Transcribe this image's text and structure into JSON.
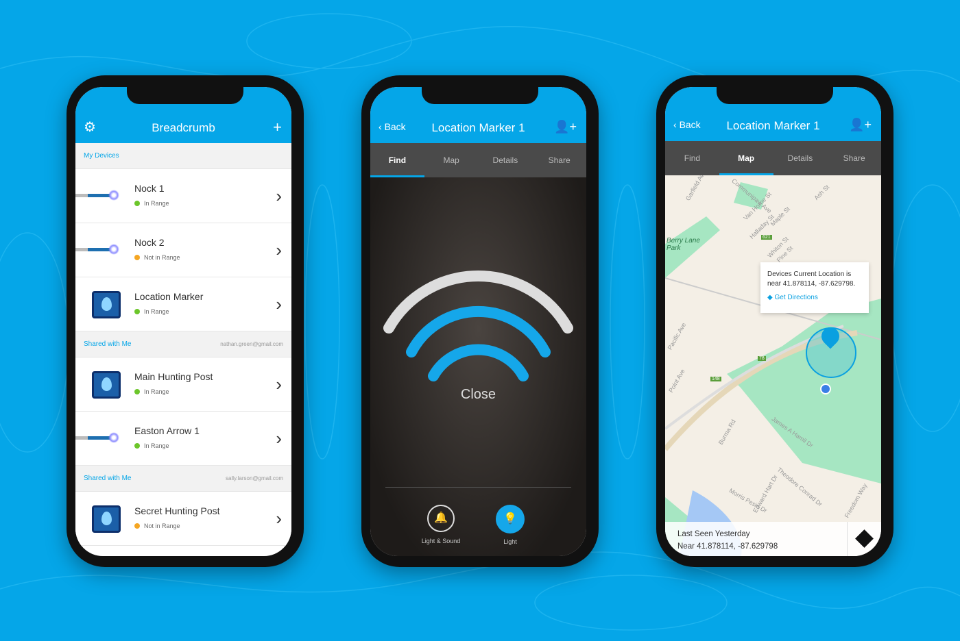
{
  "colors": {
    "accent": "#05a6e8",
    "in_range": "#6cc62a",
    "not_in_range": "#f5a623",
    "tab_bar": "#4a4a4a",
    "park": "#a6e6c2"
  },
  "phone1": {
    "title": "Breadcrumb",
    "left_icon": "gear-icon",
    "right_icon": "plus-icon",
    "sections": [
      {
        "label": "My Devices",
        "email": "",
        "devices": [
          {
            "name": "Nock 1",
            "status": "In Range",
            "type": "nock"
          },
          {
            "name": "Nock 2",
            "status": "Not in Range",
            "type": "nock"
          },
          {
            "name": "Location Marker",
            "status": "In Range",
            "type": "marker"
          }
        ]
      },
      {
        "label": "Shared with Me",
        "email": "nathan.green@gmail.com",
        "devices": [
          {
            "name": "Main Hunting Post",
            "status": "In Range",
            "type": "marker"
          },
          {
            "name": "Easton Arrow 1",
            "status": "In Range",
            "type": "nock"
          }
        ]
      },
      {
        "label": "Shared with Me",
        "email": "sally.larson@gmail.com",
        "devices": [
          {
            "name": "Secret Hunting Post",
            "status": "Not in Range",
            "type": "marker"
          }
        ]
      }
    ]
  },
  "phone2": {
    "back": "Back",
    "title": "Location Marker 1",
    "tabs": [
      "Find",
      "Map",
      "Details",
      "Share"
    ],
    "active_tab": "Find",
    "proximity": "Close",
    "signal_bars_active": 2,
    "signal_bars_total": 3,
    "actions": [
      {
        "label": "Light & Sound",
        "icon": "bell-icon",
        "active": false
      },
      {
        "label": "Light",
        "icon": "bulb-icon",
        "active": true
      }
    ]
  },
  "phone3": {
    "back": "Back",
    "title": "Location Marker 1",
    "tabs": [
      "Find",
      "Map",
      "Details",
      "Share"
    ],
    "active_tab": "Map",
    "popup": {
      "line1": "Devices Current Location is",
      "line2": "near 41.878114, -87.629798.",
      "link": "Get Directions"
    },
    "footer": {
      "line1": "Last Seen Yesterday",
      "line2": "Near 41.878114, -87.629798"
    },
    "map_labels": [
      "Berry Lane Park",
      "Communipaw Ave",
      "Garfield Ave",
      "Van Horne St",
      "Halladay St",
      "Maple St",
      "Whiton St",
      "Pine St",
      "Ash St",
      "Pacific Ave",
      "Point Ave",
      "Burma Rd",
      "James A Hamil Dr",
      "Edward Hart Dr",
      "Theodore Conrad Dr",
      "Morris Pesin Dr",
      "Freedom Way",
      "148",
      "78",
      "621"
    ]
  }
}
